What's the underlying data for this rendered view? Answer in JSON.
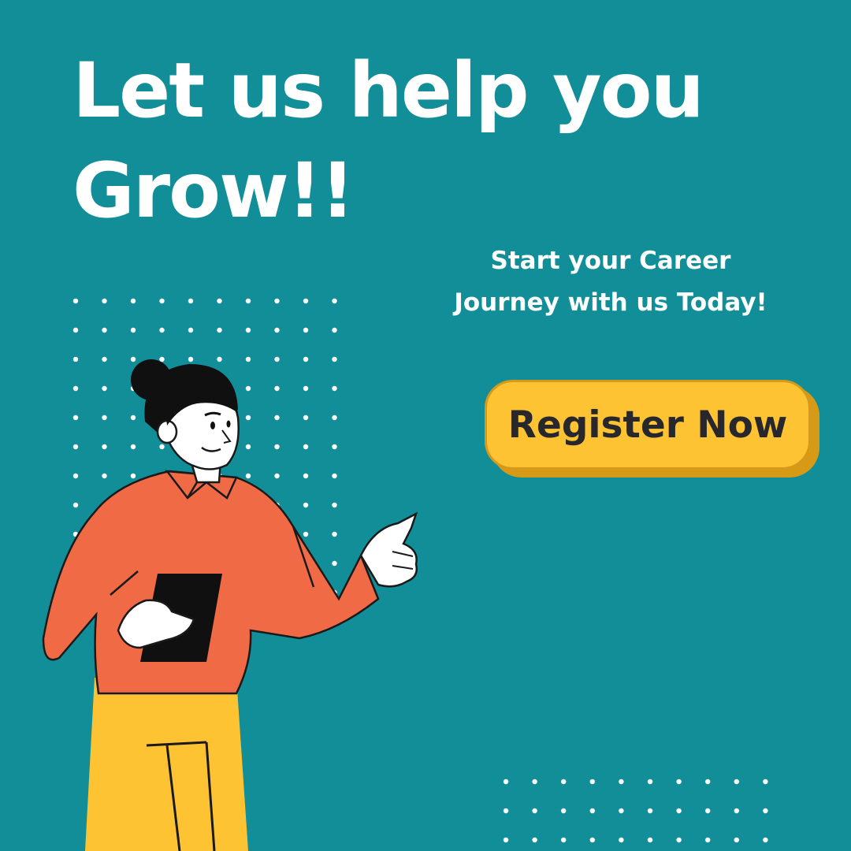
{
  "headline": {
    "line1": "Let us help you",
    "line2": "Grow!!"
  },
  "subtitle": {
    "line1": "Start your Career",
    "line2": "Journey with us Today!"
  },
  "cta": {
    "label": "Register Now"
  },
  "colors": {
    "background": "#128e98",
    "accent_button": "#fdc332",
    "button_text": "#27272c",
    "shirt": "#f06a46",
    "pants": "#fdc332",
    "text": "#ffffff"
  },
  "illustration": {
    "icon": "person-pointing-with-tablet"
  }
}
